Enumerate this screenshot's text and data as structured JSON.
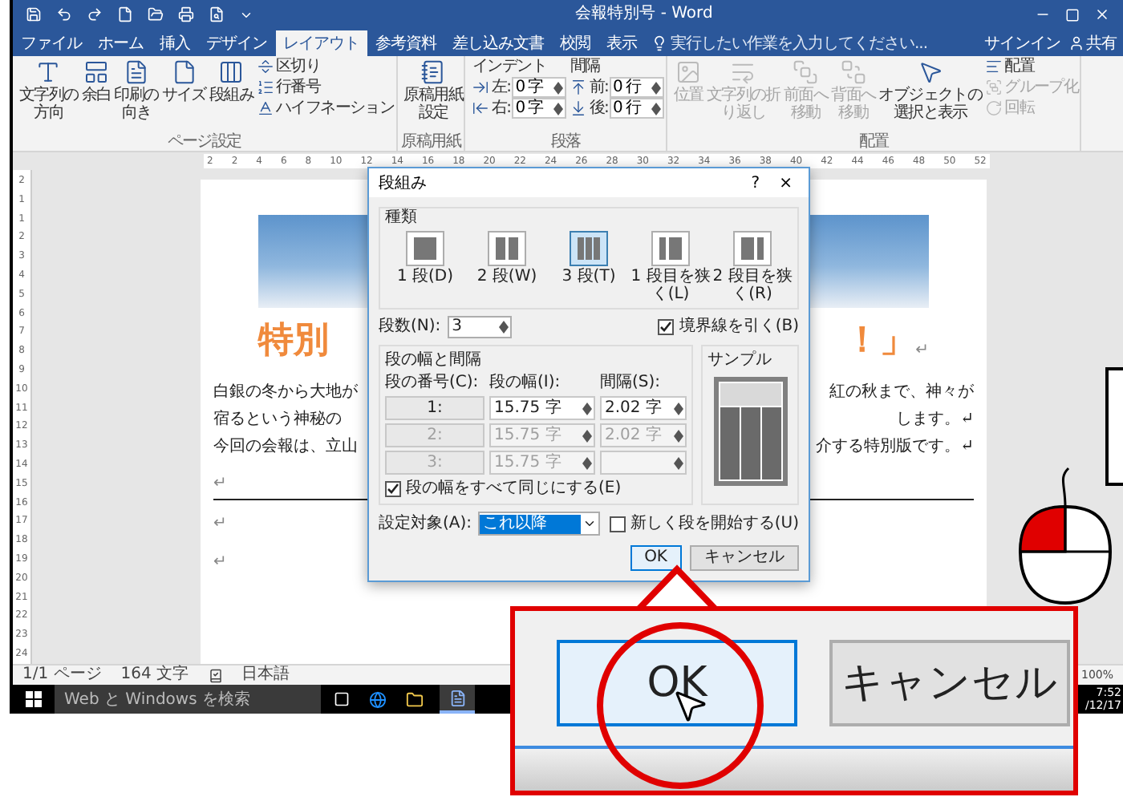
{
  "window": {
    "title": "会報特別号 - Word"
  },
  "ribbon_tabs": [
    {
      "label": "ファイル",
      "selected": false
    },
    {
      "label": "ホーム",
      "selected": false
    },
    {
      "label": "挿入",
      "selected": false
    },
    {
      "label": "デザイン",
      "selected": false
    },
    {
      "label": "レイアウト",
      "selected": true
    },
    {
      "label": "参考資料",
      "selected": false
    },
    {
      "label": "差し込み文書",
      "selected": false
    },
    {
      "label": "校閲",
      "selected": false
    },
    {
      "label": "表示",
      "selected": false
    }
  ],
  "tell_me": {
    "placeholder": "実行したい作業を入力してください..."
  },
  "account": {
    "sign_in": "サインイン",
    "share": "共有"
  },
  "ribbon_groups": [
    {
      "label": "ページ設定",
      "columns": [
        [
          {
            "kind": "large",
            "lines": [
              "文字列の",
              "方向"
            ],
            "disabled": false
          }
        ],
        [
          {
            "kind": "large",
            "lines": [
              "余白"
            ],
            "disabled": false
          }
        ],
        [
          {
            "kind": "large",
            "lines": [
              "印刷の",
              "向き"
            ],
            "disabled": false
          }
        ],
        [
          {
            "kind": "large",
            "lines": [
              "サイズ"
            ],
            "disabled": false
          }
        ],
        [
          {
            "kind": "large",
            "lines": [
              "段組み"
            ],
            "disabled": false
          }
        ],
        [
          {
            "kind": "small",
            "label": "区切り",
            "disabled": false
          },
          {
            "kind": "small",
            "label": "行番号",
            "disabled": false
          },
          {
            "kind": "small",
            "label": "ハイフネーション",
            "disabled": false
          }
        ]
      ]
    },
    {
      "label": "原稿用紙",
      "columns": [
        [
          {
            "kind": "large",
            "lines": [
              "原稿用紙",
              "設定"
            ],
            "disabled": false
          }
        ]
      ]
    },
    {
      "label": "段落",
      "columns": [
        [
          {
            "kind": "heading",
            "label": "インデント"
          },
          {
            "kind": "field",
            "label": "左:",
            "value": "0 字"
          },
          {
            "kind": "field",
            "label": "右:",
            "value": "0 字"
          }
        ],
        [
          {
            "kind": "heading",
            "label": "間隔"
          },
          {
            "kind": "field",
            "label": "前:",
            "value": "0 行"
          },
          {
            "kind": "field",
            "label": "後:",
            "value": "0 行"
          }
        ]
      ]
    },
    {
      "label": "配置",
      "columns": [
        [
          {
            "kind": "large",
            "lines": [
              "位置"
            ],
            "disabled": true
          }
        ],
        [
          {
            "kind": "large",
            "lines": [
              "文字列の折",
              "り返し"
            ],
            "disabled": true
          }
        ],
        [
          {
            "kind": "large",
            "lines": [
              "前面へ",
              "移動"
            ],
            "disabled": true
          }
        ],
        [
          {
            "kind": "large",
            "lines": [
              "背面へ",
              "移動"
            ],
            "disabled": true
          }
        ],
        [
          {
            "kind": "large",
            "lines": [
              "オブジェクトの",
              "選択と表示"
            ],
            "disabled": false
          }
        ],
        [
          {
            "kind": "small",
            "label": "配置",
            "disabled": false
          },
          {
            "kind": "small",
            "label": "グループ化",
            "disabled": true
          },
          {
            "kind": "small",
            "label": "回転",
            "disabled": true
          }
        ]
      ]
    }
  ],
  "ruler": {
    "numbers": [
      "2",
      "2",
      "4",
      "6",
      "8",
      "10",
      "12",
      "14",
      "16",
      "18",
      "20",
      "22",
      "24",
      "26",
      "28",
      "30",
      "32",
      "34",
      "36",
      "38",
      "40",
      "42",
      "44",
      "46",
      "48",
      "50",
      "52"
    ]
  },
  "vertical_ruler": {
    "numbers": [
      "2",
      "1",
      "1",
      "2",
      "3",
      "4",
      "5",
      "6",
      "7",
      "8",
      "9",
      "10",
      "11",
      "12",
      "13",
      "14",
      "15",
      "16",
      "17",
      "18",
      "19",
      "20",
      "21",
      "22",
      "23",
      "24"
    ]
  },
  "document": {
    "title_left": "特別",
    "title_right": "！」",
    "title_mark": "↵",
    "body_lines": [
      {
        "left": "白銀の冬から大地が",
        "right": "紅の秋まで、神々が"
      },
      {
        "left": "宿るという神秘の",
        "right": "します。↵"
      },
      {
        "left": "今回の会報は、立山",
        "right": "介する特別版です。↵"
      }
    ],
    "marks_before_rule": [
      "↵"
    ],
    "marks_after_rule": [
      "↵",
      "↵"
    ]
  },
  "dialog": {
    "title": "段組み",
    "help": "?",
    "close": "×",
    "presets_label": "種類",
    "presets": [
      {
        "kind": "one",
        "label": "1 段(D)",
        "selected": false
      },
      {
        "kind": "two",
        "label": "2 段(W)",
        "selected": false
      },
      {
        "kind": "three",
        "label": "3 段(T)",
        "selected": true
      },
      {
        "kind": "left",
        "label": "1 段目を狭く(L)",
        "selected": false
      },
      {
        "kind": "right",
        "label": "2 段目を狭く(R)",
        "selected": false
      }
    ],
    "count": {
      "label": "段数(N):",
      "value": "3"
    },
    "line_between": {
      "label": "境界線を引く(B)",
      "checked": true
    },
    "widths": {
      "label": "段の幅と間隔",
      "headers": [
        "段の番号(C):",
        "段の幅(I):",
        "間隔(S):"
      ],
      "rows": [
        {
          "number": "1:",
          "width": "15.75 字",
          "spacing": "2.02 字",
          "disabled": false
        },
        {
          "number": "2:",
          "width": "15.75 字",
          "spacing": "2.02 字",
          "disabled": true
        },
        {
          "number": "3:",
          "width": "15.75 字",
          "disabled": true
        }
      ]
    },
    "equal_width": {
      "label": "段の幅をすべて同じにする(E)",
      "checked": true
    },
    "preview": {
      "label": "サンプル"
    },
    "apply_to": {
      "label": "設定対象(A):",
      "value": "これ以降"
    },
    "new_column": {
      "label": "新しく段を開始する(U)",
      "checked": false
    },
    "buttons": [
      {
        "label": "OK",
        "default": true
      },
      {
        "label": "キャンセル",
        "default": false
      }
    ]
  },
  "status_bar": {
    "page": "1/1 ページ",
    "words": "164 文字",
    "language": "日本語",
    "zoom": "100%"
  },
  "taskbar": {
    "search": {
      "placeholder": "Web と Windows を検索"
    },
    "time": "7:52",
    "date": "/12/17"
  },
  "callout": {
    "buttons": [
      {
        "label": "OK",
        "default": true
      },
      {
        "label": "キャンセル",
        "default": false
      }
    ]
  }
}
